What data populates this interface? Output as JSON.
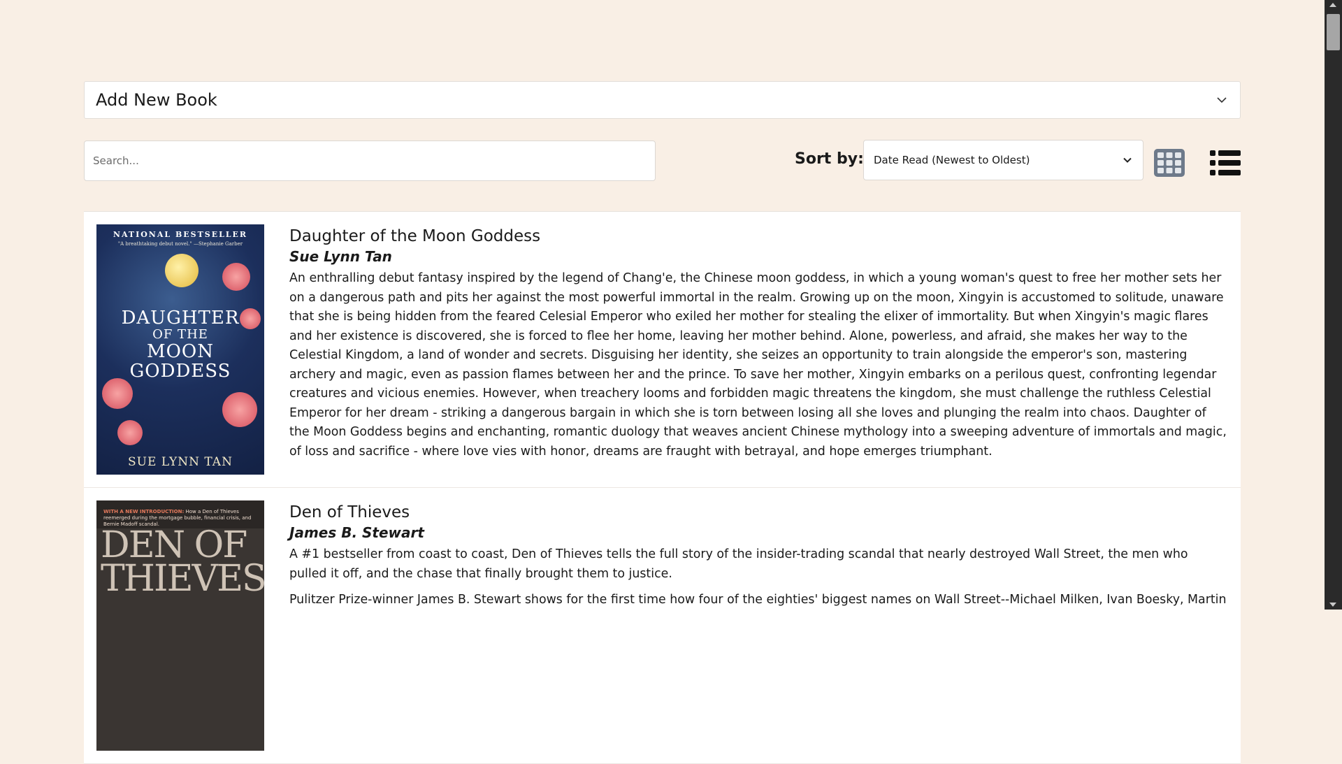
{
  "accordion": {
    "title": "Add New Book",
    "icon": "chevron-down-icon"
  },
  "toolbar": {
    "search_placeholder": "Search...",
    "sort_label": "Sort by:",
    "sort_selected": "Date Read (Newest to Oldest)",
    "grid_icon": "grid-view-icon",
    "list_icon": "list-view-icon"
  },
  "books": [
    {
      "title": "Daughter of the Moon Goddess",
      "author": "Sue Lynn Tan",
      "description": [
        "An enthralling debut fantasy inspired by the legend of Chang'e, the Chinese moon goddess, in which a young woman's quest to free her mother sets her on a dangerous path and pits her against the most powerful immortal in the realm. Growing up on the moon, Xingyin is accustomed to solitude, unaware that she is being hidden from the feared Celesial Emperor who exiled her mother for stealing the elixer of immortality. But when Xingyin's magic flares and her existence is discovered, she is forced to flee her home, leaving her mother behind. Alone, powerless, and afraid, she makes her way to the Celestial Kingdom, a land of wonder and secrets. Disguising her identity, she seizes an opportunity to train alongside the emperor's son, mastering archery and magic, even as passion flames between her and the prince. To save her mother, Xingyin embarks on a perilous quest, confronting legendar creatures and vicious enemies. However, when treachery looms and forbidden magic threatens the kingdom, she must challenge the ruthless Celestial Emperor for her dream - striking a dangerous bargain in which she is torn between losing all she loves and plunging the realm into chaos. Daughter of the Moon Goddess begins and enchanting, romantic duology that weaves ancient Chinese mythology into a sweeping adventure of immortals and magic, of loss and sacrifice - where love vies with honor, dreams are fraught with betrayal, and hope emerges triumphant."
      ],
      "cover": {
        "top_text": "NATIONAL BESTSELLER",
        "sub_text": "\"A breathtaking debut novel.\" —Stephanie Garber",
        "title_lines": [
          "DAUGHTER",
          "OF THE",
          "MOON",
          "GODDESS"
        ],
        "author": "SUE LYNN TAN"
      }
    },
    {
      "title": "Den of Thieves",
      "author": "James B. Stewart",
      "description": [
        "A #1 bestseller from coast to coast, Den of Thieves tells the full story of the insider-trading scandal that nearly destroyed Wall Street, the men who pulled it off, and the chase that finally brought them to justice.",
        "Pulitzer Prize-winner James B. Stewart shows for the first time how four of the eighties' biggest names on Wall Street--Michael Milken, Ivan Boesky, Martin"
      ],
      "cover": {
        "intro_label": "WITH A NEW INTRODUCTION:",
        "intro_text": "How a Den of Thieves reemerged during the mortgage bubble, financial crisis, and Bernie Madoff scandal.",
        "title_lines": [
          "DEN OF",
          "THIEVES"
        ]
      }
    }
  ],
  "colors": {
    "page_bg": "#f9efe5",
    "card_bg": "#ffffff",
    "icon": "#6e7a8a"
  }
}
